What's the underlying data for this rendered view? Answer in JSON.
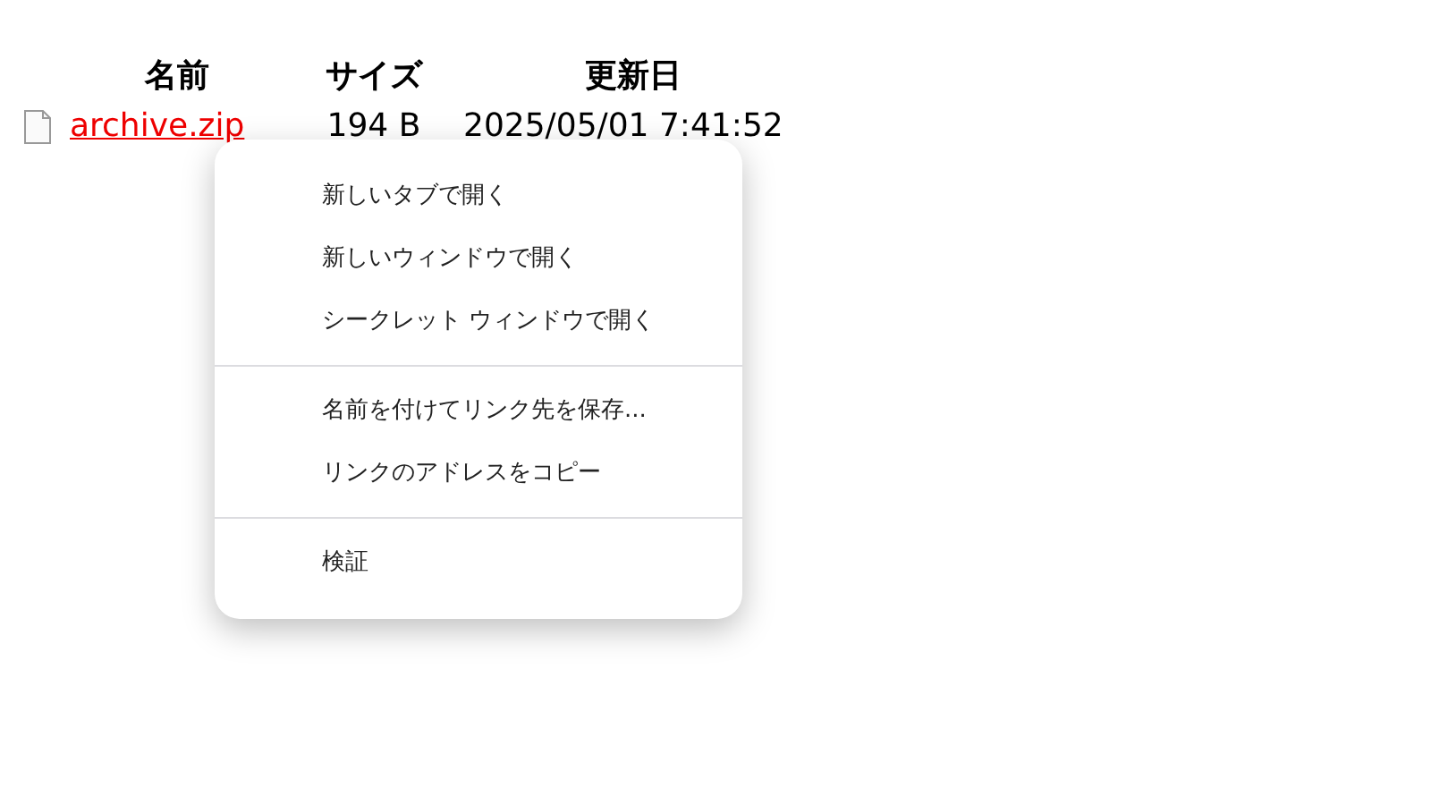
{
  "table": {
    "columns": [
      "名前",
      "サイズ",
      "更新日"
    ],
    "rows": [
      {
        "name": "archive.zip",
        "size": "194 B",
        "modified": "2025/05/01 7:41:52"
      }
    ]
  },
  "context_menu": {
    "groups": [
      [
        "新しいタブで開く",
        "新しいウィンドウで開く",
        "シークレット ウィンドウで開く"
      ],
      [
        "名前を付けてリンク先を保存...",
        "リンクのアドレスをコピー"
      ],
      [
        "検証"
      ]
    ]
  }
}
